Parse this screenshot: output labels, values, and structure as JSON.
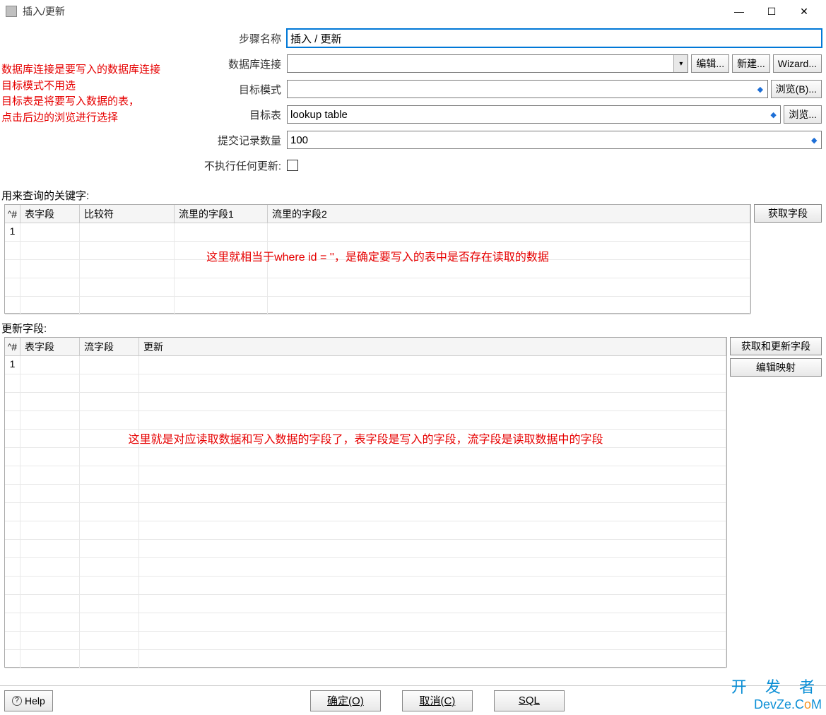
{
  "window": {
    "title": "插入/更新"
  },
  "form": {
    "step_name_label": "步骤名称",
    "step_name_value": "插入 / 更新",
    "db_conn_label": "数据库连接",
    "db_conn_value": "",
    "edit_btn": "编辑...",
    "new_btn": "新建...",
    "wizard_btn": "Wizard...",
    "target_schema_label": "目标模式",
    "target_schema_value": "",
    "browse_b_btn": "浏览(B)...",
    "target_table_label": "目标表",
    "target_table_value": "lookup table",
    "browse_btn": "浏览...",
    "commit_size_label": "提交记录数量",
    "commit_size_value": "100",
    "no_update_label": "不执行任何更新:"
  },
  "annotations": {
    "left_block": "数据库连接是要写入的数据库连接\n目标模式不用选\n目标表是将要写入数据的表，\n点击后边的浏览进行选择",
    "table1_note": "这里就相当于where id = ''，是确定要写入的表中是否存在读取的数据",
    "table2_note": "这里就是对应读取数据和写入数据的字段了，表字段是写入的字段，流字段是读取数据中的字段"
  },
  "section1": {
    "label": "用来查询的关键字:",
    "headers": {
      "hash": "#",
      "col1": "表字段",
      "col2": "比较符",
      "col3": "流里的字段1",
      "col4": "流里的字段2"
    },
    "row1_num": "1",
    "get_fields_btn": "获取字段"
  },
  "section2": {
    "label": "更新字段:",
    "headers": {
      "hash": "#",
      "col1": "表字段",
      "col2": "流字段",
      "col3": "更新"
    },
    "row1_num": "1",
    "get_update_btn": "获取和更新字段",
    "edit_mapping_btn": "编辑映射"
  },
  "bottom": {
    "help": "Help",
    "ok": "确定(O)",
    "cancel": "取消(C)",
    "sql": "SQL"
  },
  "watermark": {
    "cn": "开 发 者",
    "en_pre": "DevZe.C",
    "en_o": "o",
    "en_post": "M"
  }
}
